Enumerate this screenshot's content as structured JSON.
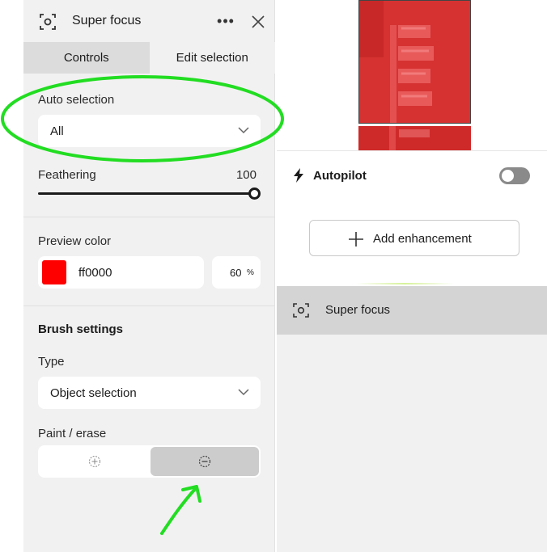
{
  "header": {
    "title": "Super focus",
    "more_label": "•••"
  },
  "tabs": [
    {
      "label": "Controls",
      "active": false
    },
    {
      "label": "Edit selection",
      "active": true
    }
  ],
  "auto_selection": {
    "label": "Auto selection",
    "value": "All"
  },
  "feathering": {
    "label": "Feathering",
    "value": "100",
    "fraction": 1.0
  },
  "preview_color": {
    "label": "Preview color",
    "hex": "ff0000",
    "swatch": "#ff0000",
    "opacity": "60",
    "opacity_unit": "%"
  },
  "brush_settings": {
    "title": "Brush settings",
    "type_label": "Type",
    "type_value": "Object selection",
    "paint_erase_label": "Paint / erase",
    "selected_mode": "erase"
  },
  "right": {
    "autopilot_label": "Autopilot",
    "autopilot_on": false,
    "add_enhancement_label": "Add enhancement",
    "layer_label": "Super focus"
  },
  "colors": {
    "annotation": "#22dd22",
    "panel_bg": "#f1f1f1",
    "toggle_off": "#8a8a8a"
  }
}
